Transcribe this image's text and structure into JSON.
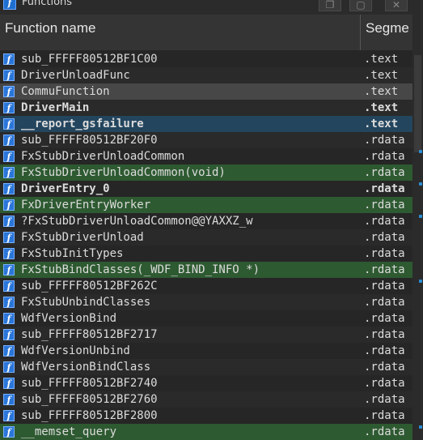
{
  "window": {
    "title": "Functions",
    "icon": "function-icon",
    "buttons": [
      "restore-icon",
      "maximize-icon",
      "close-icon"
    ]
  },
  "columns": {
    "name": "Function name",
    "segment": "Segme"
  },
  "icon_glyph": "f",
  "rows": [
    {
      "name": "sub_FFFFF80512BF1C00",
      "segment": ".text",
      "style": "normal"
    },
    {
      "name": "DriverUnloadFunc",
      "segment": ".text",
      "style": "normal"
    },
    {
      "name": "CommuFunction",
      "segment": ".text",
      "style": "sel-gray"
    },
    {
      "name": "DriverMain",
      "segment": ".text",
      "style": "bold"
    },
    {
      "name": "__report_gsfailure",
      "segment": ".text",
      "style": "sel-blue-bold"
    },
    {
      "name": "sub_FFFFF80512BF20F0",
      "segment": ".rdata",
      "style": "normal"
    },
    {
      "name": "FxStubDriverUnloadCommon",
      "segment": ".rdata",
      "style": "normal"
    },
    {
      "name": "FxStubDriverUnloadCommon(void)",
      "segment": ".rdata",
      "style": "sel-green"
    },
    {
      "name": "DriverEntry_0",
      "segment": ".rdata",
      "style": "bold"
    },
    {
      "name": "FxDriverEntryWorker",
      "segment": ".rdata",
      "style": "sel-green"
    },
    {
      "name": "?FxStubDriverUnloadCommon@@YAXXZ_w",
      "segment": ".rdata",
      "style": "normal"
    },
    {
      "name": "FxStubDriverUnload",
      "segment": ".rdata",
      "style": "normal"
    },
    {
      "name": "FxStubInitTypes",
      "segment": ".rdata",
      "style": "normal"
    },
    {
      "name": "FxStubBindClasses(_WDF_BIND_INFO *)",
      "segment": ".rdata",
      "style": "sel-green"
    },
    {
      "name": "sub_FFFFF80512BF262C",
      "segment": ".rdata",
      "style": "normal"
    },
    {
      "name": "FxStubUnbindClasses",
      "segment": ".rdata",
      "style": "normal"
    },
    {
      "name": "WdfVersionBind",
      "segment": ".rdata",
      "style": "normal"
    },
    {
      "name": "sub_FFFFF80512BF2717",
      "segment": ".rdata",
      "style": "normal"
    },
    {
      "name": "WdfVersionUnbind",
      "segment": ".rdata",
      "style": "normal"
    },
    {
      "name": "WdfVersionBindClass",
      "segment": ".rdata",
      "style": "normal"
    },
    {
      "name": "sub_FFFFF80512BF2740",
      "segment": ".rdata",
      "style": "normal"
    },
    {
      "name": "sub_FFFFF80512BF2760",
      "segment": ".rdata",
      "style": "normal"
    },
    {
      "name": "sub_FFFFF80512BF2800",
      "segment": ".rdata",
      "style": "normal"
    },
    {
      "name": "__memset_query",
      "segment": ".rdata",
      "style": "sel-green"
    }
  ],
  "colors": {
    "function_icon": "#2a75d8",
    "selection_gray": "#474747",
    "selection_blue": "#23455e",
    "selection_green": "#2e5a31"
  }
}
